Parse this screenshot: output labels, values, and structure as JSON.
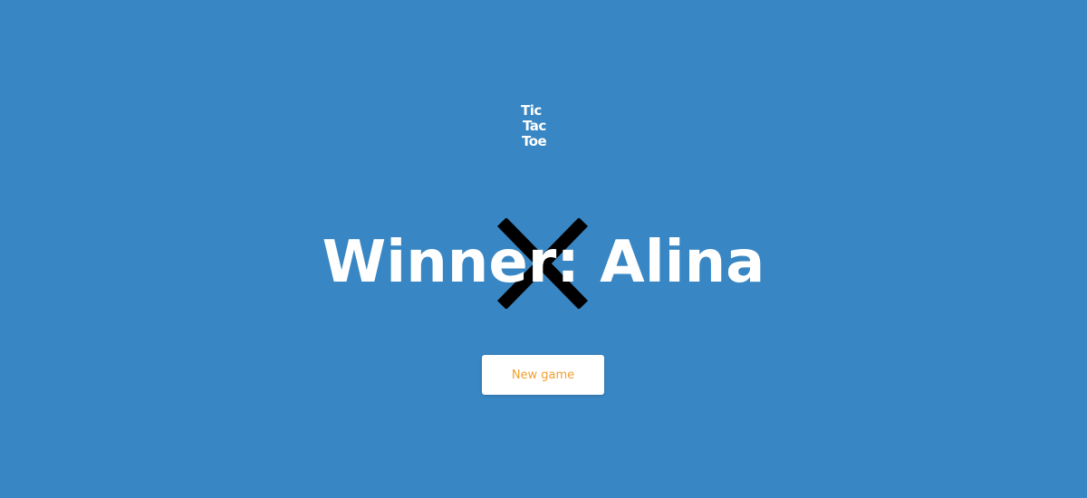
{
  "logo": {
    "line1": "Tic",
    "line2": "Tac",
    "line3": "Toe"
  },
  "result": {
    "text": "Winner: Alina",
    "winner_mark": "X"
  },
  "actions": {
    "new_game_label": "New game"
  },
  "colors": {
    "background": "#3886c3",
    "text": "#ffffff",
    "mark": "#000000",
    "button_background": "#ffffff",
    "button_text": "#f0a032"
  }
}
